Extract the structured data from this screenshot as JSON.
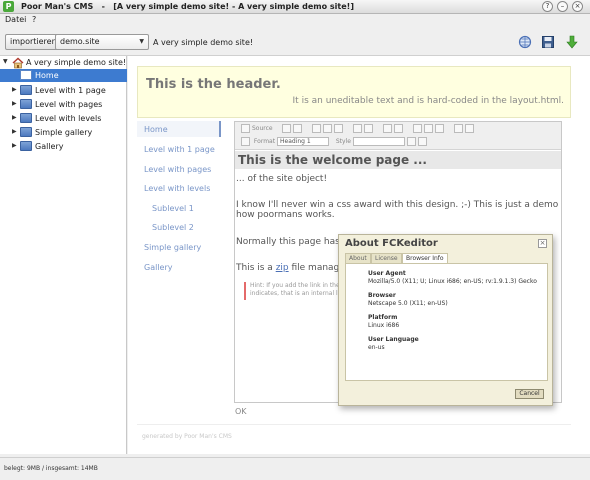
{
  "window": {
    "app_icon_letter": "P",
    "title": "Poor Man's CMS   -   [A very simple demo site! - A very simple demo site!]",
    "controls": [
      "?",
      "–",
      "×"
    ]
  },
  "menu": {
    "file": "Datei",
    "help": "?"
  },
  "toolbar": {
    "import_label": "importieren",
    "site_select_value": "demo.site",
    "site_title": "A very simple demo site!"
  },
  "tree": {
    "root": "A very simple demo site!",
    "items": [
      {
        "label": "Home"
      },
      {
        "label": "Level with 1 page"
      },
      {
        "label": "Level with pages"
      },
      {
        "label": "Level with levels"
      },
      {
        "label": "Simple gallery"
      },
      {
        "label": "Gallery"
      }
    ]
  },
  "page": {
    "header_title": "This is the header.",
    "header_subtitle": "It is an uneditable text and is hard-coded in the layout.html.",
    "nav": [
      {
        "label": "Home"
      },
      {
        "label": "Level with 1 page"
      },
      {
        "label": "Level with pages"
      },
      {
        "label": "Level with levels"
      },
      {
        "label": "Sublevel 1"
      },
      {
        "label": "Sublevel 2"
      },
      {
        "label": "Simple gallery"
      },
      {
        "label": "Gallery"
      }
    ],
    "footer": "generated by Poor Man's CMS",
    "ok_text": "OK"
  },
  "editor": {
    "toolbar": {
      "source_label": "Source",
      "format_label": "Format",
      "format_value": "Heading 1",
      "style_label": "Style",
      "style_value": ""
    },
    "welcome_heading": "This is the welcome page ...",
    "line1": "... of the site object!",
    "line2a": "I know I'll never win a css award with this design. ;-) This is just a demo to show you",
    "line2b": "how poormans works.",
    "line3": "Normally this page has anot",
    "line4_pre": "This is a ",
    "line4_link": "zip",
    "line4_post": " file managed b",
    "hint_a": "Hint: If you add the link in the",
    "hint_b": "indicates, that is an internal lin"
  },
  "dialog": {
    "title": "About FCKeditor",
    "close_glyph": "×",
    "tabs": [
      "About",
      "License",
      "Browser Info"
    ],
    "fields": [
      {
        "label": "User Agent",
        "value": "Mozilla/5.0 (X11; U; Linux i686; en-US; rv:1.9.1.3) Gecko"
      },
      {
        "label": "Browser",
        "value": "Netscape 5.0 (X11; en-US)"
      },
      {
        "label": "Platform",
        "value": "Linux i686"
      },
      {
        "label": "User Language",
        "value": "en-us"
      }
    ],
    "cancel_label": "Cancel"
  },
  "status": {
    "text": "belegt: 9MB / insgesamt: 14MB"
  },
  "icons": {
    "globe": "globe-icon",
    "save": "save-icon",
    "download": "download-arrow-icon",
    "folder": "folder-icon",
    "home": "house-icon"
  },
  "colors": {
    "selection": "#3d7bd0",
    "header_bg": "#ffffe0",
    "nav_link": "#7a96c8",
    "dialog_bg": "#f3f0dc",
    "accent_green": "#4aa83a"
  }
}
